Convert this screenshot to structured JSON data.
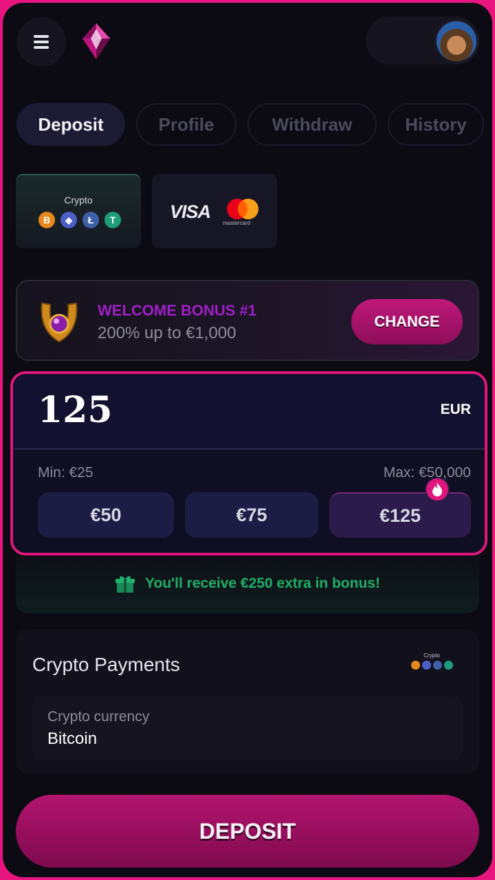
{
  "header": {
    "menu_icon": "hamburger-icon",
    "logo_icon": "gem-logo"
  },
  "tabs": [
    {
      "label": "Deposit",
      "active": true
    },
    {
      "label": "Profile",
      "active": false
    },
    {
      "label": "Withdraw",
      "active": false
    },
    {
      "label": "History",
      "active": false
    }
  ],
  "payment_methods": {
    "crypto_label": "Crypto",
    "coins": [
      "B",
      "◆",
      "Ł",
      "T"
    ],
    "card_brand_visa": "VISA",
    "card_brand_mc": "mastercard"
  },
  "bonus": {
    "title": "WELCOME BONUS #1",
    "subtitle": "200% up to €1,000",
    "change_label": "CHANGE"
  },
  "amount": {
    "value": "125",
    "currency": "EUR",
    "min": "Min: €25",
    "max": "Max: €50,000",
    "quick": [
      "€50",
      "€75",
      "€125"
    ]
  },
  "bonus_note": "You'll receive €250 extra in bonus!",
  "crypto_payments": {
    "title": "Crypto Payments",
    "badge_label": "Crypto",
    "field_label": "Crypto currency",
    "field_value": "Bitcoin"
  },
  "deposit_label": "DEPOSIT",
  "colors": {
    "accent": "#e0167c",
    "background": "#0c0b14",
    "success": "#1fae6a",
    "bonus_title": "#a01ec8"
  }
}
